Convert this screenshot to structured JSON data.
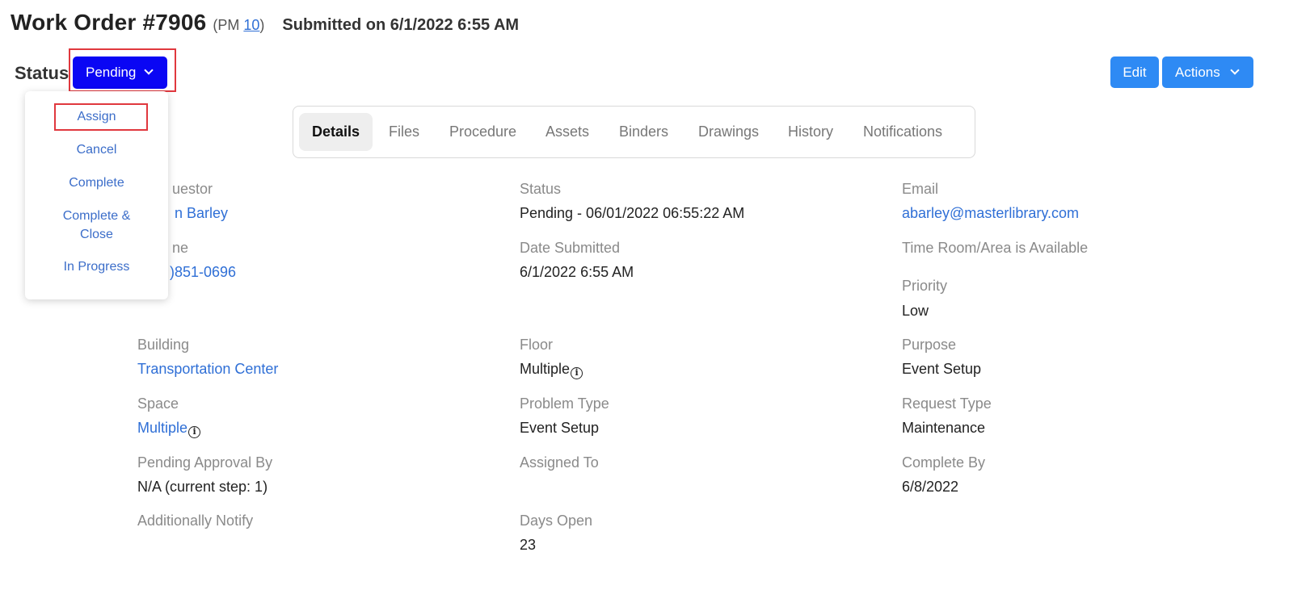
{
  "header": {
    "title": "Work Order #7906",
    "pm_prefix": "(PM ",
    "pm_number": "10",
    "pm_suffix": ")",
    "submitted": "Submitted on 6/1/2022 6:55 AM"
  },
  "status": {
    "label": "Status",
    "current": "Pending",
    "menu": [
      "Assign",
      "Cancel",
      "Complete",
      "Complete &",
      "Close",
      "In Progress"
    ]
  },
  "toolbar": {
    "edit": "Edit",
    "actions": "Actions"
  },
  "tabs": [
    "Details",
    "Files",
    "Procedure",
    "Assets",
    "Binders",
    "Drawings",
    "History",
    "Notifications"
  ],
  "fields": {
    "requestor_label": "uestor",
    "requestor_value": "n Barley",
    "phone_label": "ne",
    "phone_value": ")851-0696",
    "status_label": "Status",
    "status_value": "Pending - 06/01/2022 06:55:22 AM",
    "email_label": "Email",
    "email_value": "abarley@masterlibrary.com",
    "date_submitted_label": "Date Submitted",
    "date_submitted_value": "6/1/2022 6:55 AM",
    "time_room_label": "Time Room/Area is Available",
    "priority_label": "Priority",
    "priority_value": "Low",
    "building_label": "Building",
    "building_value": "Transportation Center",
    "floor_label": "Floor",
    "floor_value": "Multiple",
    "purpose_label": "Purpose",
    "purpose_value": "Event Setup",
    "space_label": "Space",
    "space_value": "Multiple",
    "problem_type_label": "Problem Type",
    "problem_type_value": "Event Setup",
    "request_type_label": "Request Type",
    "request_type_value": "Maintenance",
    "pending_approval_label": "Pending Approval By",
    "pending_approval_value": "N/A (current step: 1)",
    "assigned_to_label": "Assigned To",
    "complete_by_label": "Complete By",
    "complete_by_value": "6/8/2022",
    "additionally_notify_label": "Additionally Notify",
    "days_open_label": "Days Open",
    "days_open_value": "23"
  },
  "icons": {
    "info": "info-icon",
    "chevron": "chevron-down-icon"
  },
  "colors": {
    "status_button": "#0a06f4",
    "primary_button": "#2e8af4",
    "link": "#2f6fd6",
    "highlight_frame": "#e0383e"
  }
}
